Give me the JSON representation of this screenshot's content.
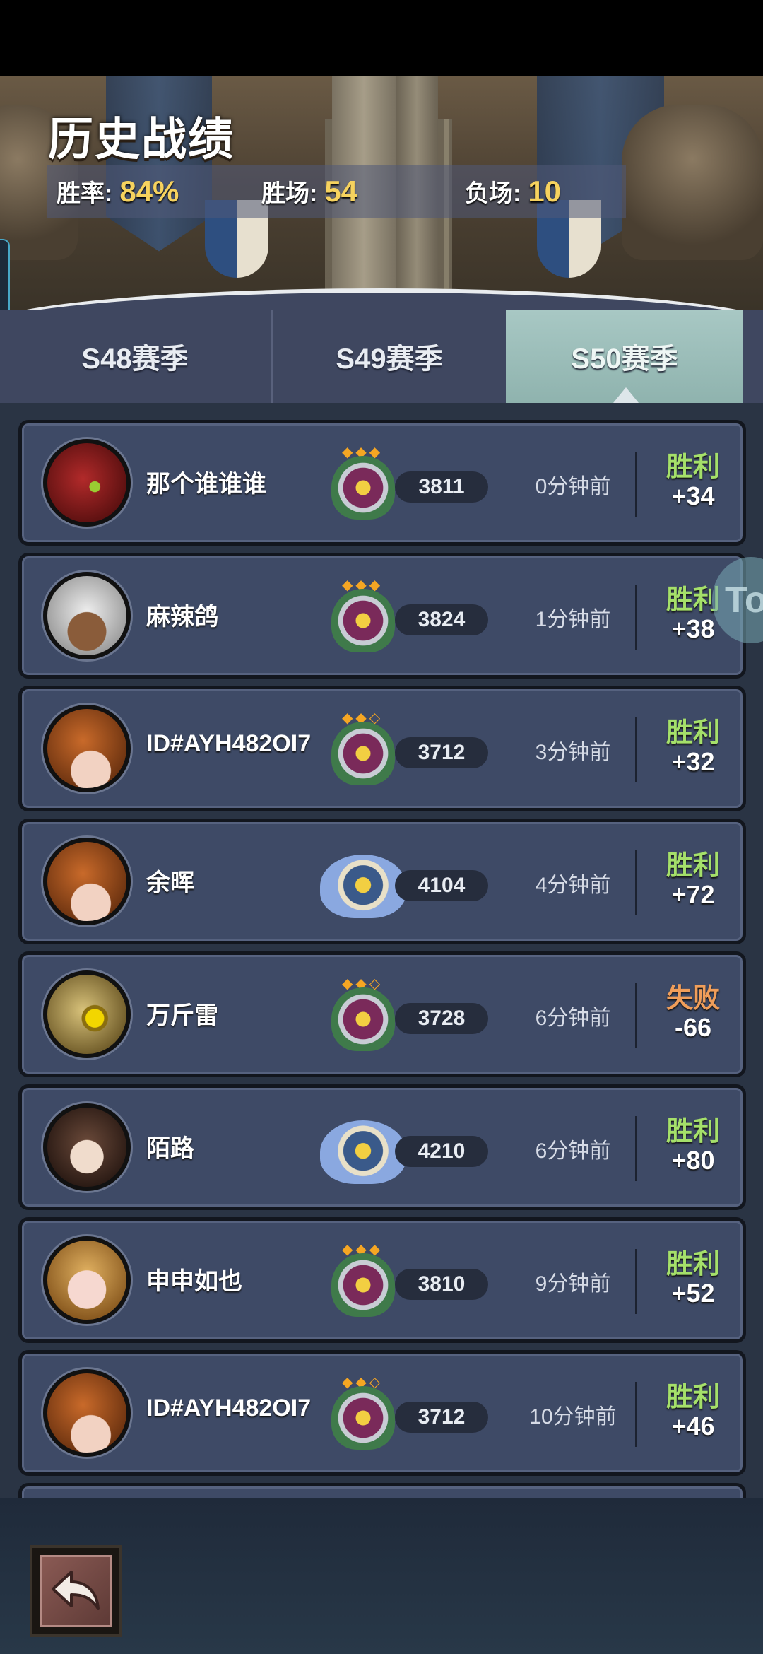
{
  "header": {
    "title": "历史战绩",
    "stats": [
      {
        "label": "胜率:",
        "value": "84%"
      },
      {
        "label": "胜场:",
        "value": "54"
      },
      {
        "label": "负场:",
        "value": "10"
      }
    ]
  },
  "tabs": [
    {
      "label": "S48赛季",
      "selected": false
    },
    {
      "label": "S49赛季",
      "selected": false
    },
    {
      "label": "S50赛季",
      "selected": true
    }
  ],
  "matches": [
    {
      "name": "那个谁谁谁",
      "avatar": "mech-avatar",
      "rank_badge": "crown-badge",
      "stars": 3,
      "score": "3811",
      "time": "0分钟前",
      "result": "胜利",
      "delta": "+34"
    },
    {
      "name": "麻辣鸽",
      "avatar": "white-hair-girl-avatar",
      "rank_badge": "crown-badge",
      "stars": 3,
      "score": "3824",
      "time": "1分钟前",
      "result": "胜利",
      "delta": "+38"
    },
    {
      "name": "ID#AYH482OI7",
      "avatar": "pumpkin-avatar",
      "rank_badge": "crown-badge",
      "stars": 2,
      "score": "3712",
      "time": "3分钟前",
      "result": "胜利",
      "delta": "+32"
    },
    {
      "name": "余晖",
      "avatar": "pumpkin-avatar",
      "rank_badge": "winged-badge",
      "stars": 0,
      "score": "4104",
      "time": "4分钟前",
      "result": "胜利",
      "delta": "+72"
    },
    {
      "name": "万斤雷",
      "avatar": "sphere-avatar",
      "rank_badge": "crown-badge",
      "stars": 2,
      "score": "3728",
      "time": "6分钟前",
      "result": "失败",
      "delta": "-66"
    },
    {
      "name": "陌路",
      "avatar": "monkey-king-avatar",
      "rank_badge": "winged-badge",
      "stars": 0,
      "score": "4210",
      "time": "6分钟前",
      "result": "胜利",
      "delta": "+80"
    },
    {
      "name": "申申如也",
      "avatar": "blonde-avatar",
      "rank_badge": "crown-badge",
      "stars": 3,
      "score": "3810",
      "time": "9分钟前",
      "result": "胜利",
      "delta": "+52"
    },
    {
      "name": "ID#AYH482OI7",
      "avatar": "pumpkin-avatar",
      "rank_badge": "crown-badge",
      "stars": 2,
      "score": "3712",
      "time": "10分钟前",
      "result": "胜利",
      "delta": "+46"
    }
  ],
  "colors": {
    "win": "#a5e06a",
    "loss": "#f09e5a",
    "stat_value": "#f6d25e"
  },
  "icons": {
    "back": "back-arrow-icon",
    "floating": "floating-assist-button"
  },
  "floating_button": {
    "label": "To"
  }
}
